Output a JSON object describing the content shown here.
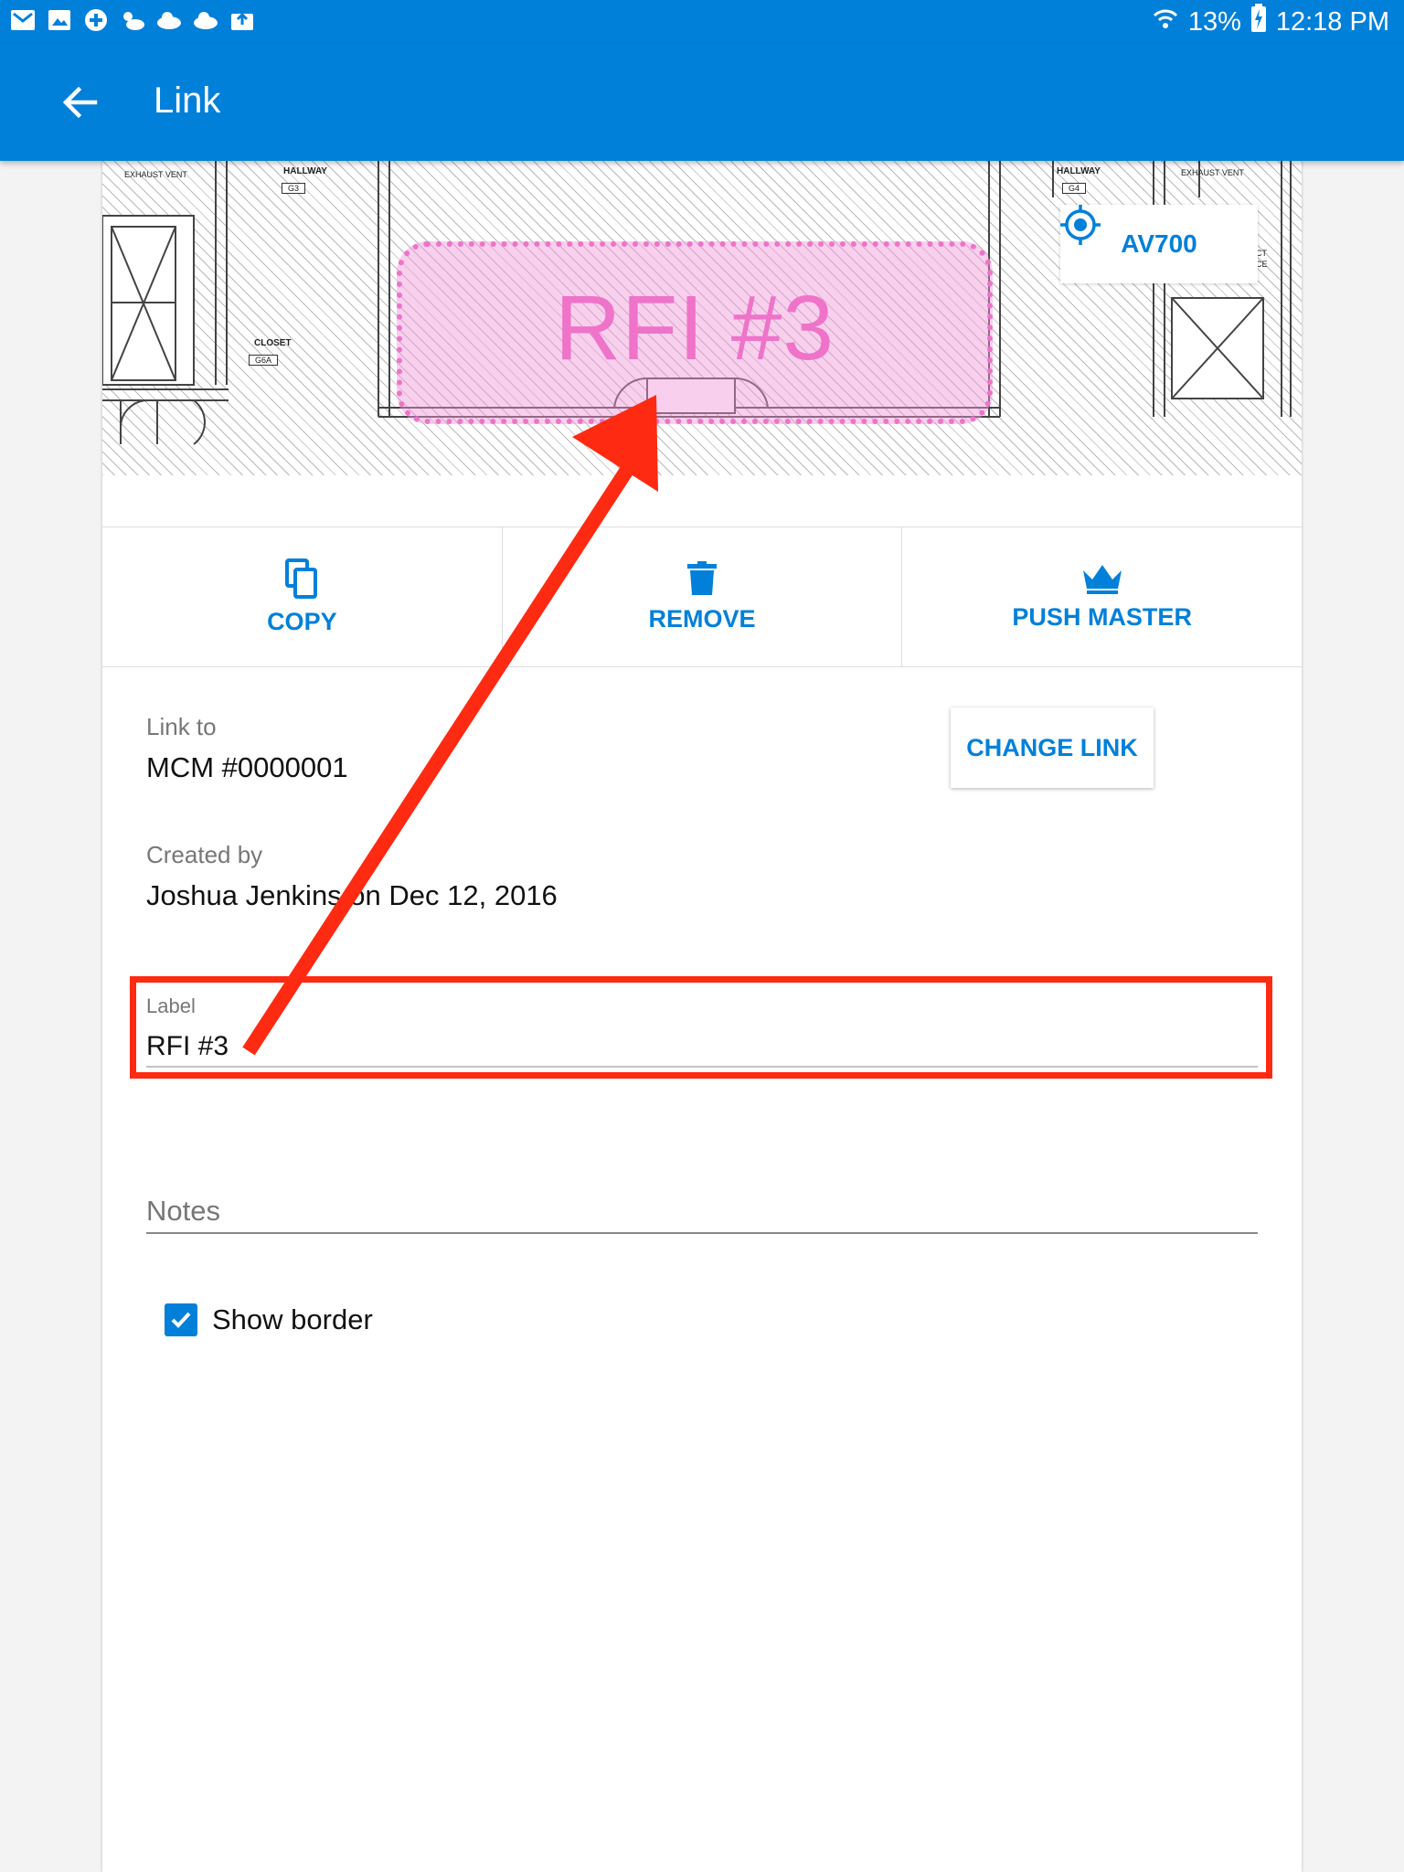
{
  "status_bar": {
    "battery": "13%",
    "time": "12:18 PM",
    "left_icons": [
      "mail-icon",
      "gallery-icon",
      "plus-icon",
      "weather-icon",
      "cloud-icon",
      "cloud-icon",
      "upload-icon"
    ],
    "right_icons": [
      "wifi-icon",
      "battery-charging-icon"
    ]
  },
  "app_bar": {
    "title": "Link",
    "back_icon": "arrow-back-icon"
  },
  "plan": {
    "labels": {
      "exhaust_vent_left": "EXHAUST VENT",
      "hallway_left": "HALLWAY",
      "hallway_left_tag": "G3",
      "closet": "CLOSET",
      "closet_tag": "G6A",
      "hallway_right": "HALLWAY",
      "hallway_right_tag": "G4",
      "exhaust_vent_right": "EXHAUST VENT",
      "cut_text_1": "CT",
      "cut_text_2": "CE"
    },
    "markup_label": "RFI #3",
    "markup_color": "#ee73c9",
    "chip": {
      "icon": "target-icon",
      "label": "AV700"
    }
  },
  "actions": [
    {
      "icon": "copy-icon",
      "label": "COPY"
    },
    {
      "icon": "trash-icon",
      "label": "REMOVE"
    },
    {
      "icon": "crown-icon",
      "label": "PUSH MASTER"
    }
  ],
  "details": {
    "link_to_caption": "Link to",
    "link_to_value": "MCM #0000001",
    "change_link_label": "CHANGE LINK",
    "created_by_caption": "Created by",
    "created_by_value": "Joshua Jenkins on Dec 12, 2016"
  },
  "form": {
    "label_caption": "Label",
    "label_value": "RFI #3",
    "notes_placeholder": "Notes",
    "show_border_label": "Show border",
    "show_border_checked": true
  },
  "annotation": {
    "highlight_color": "#ff2a12",
    "arrow_color": "#ff2a12"
  },
  "colors": {
    "primary": "#0180da",
    "background": "#f3f3f3"
  }
}
